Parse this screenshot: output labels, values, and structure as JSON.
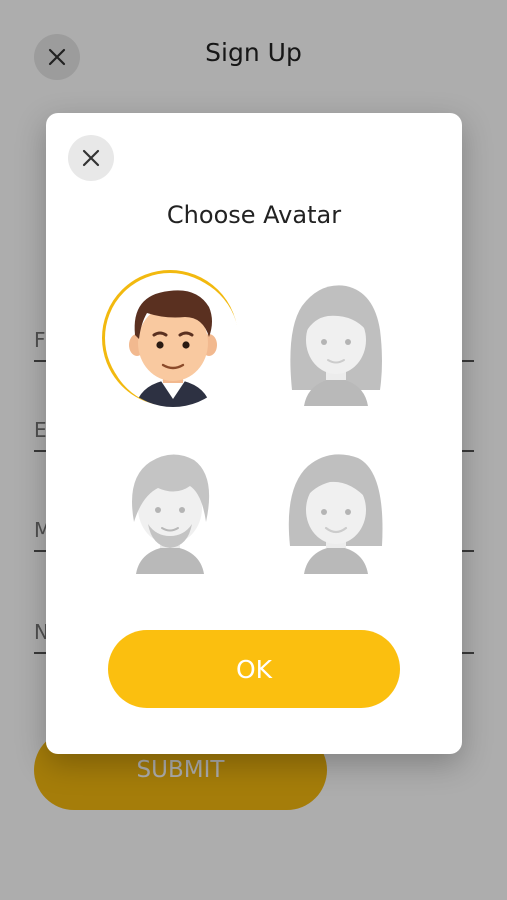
{
  "header": {
    "title": "Sign Up"
  },
  "form": {
    "fields": [
      {
        "label": "F"
      },
      {
        "label": "E"
      },
      {
        "label": "M"
      },
      {
        "label": "N"
      }
    ],
    "submit_label": "SUBMIT"
  },
  "modal": {
    "title": "Choose Avatar",
    "ok_label": "OK",
    "avatars": [
      {
        "name": "man-short-hair",
        "selected": true
      },
      {
        "name": "woman-long-hair",
        "selected": false
      },
      {
        "name": "man-bearded",
        "selected": false
      },
      {
        "name": "woman-bob-hair",
        "selected": false
      }
    ]
  },
  "colors": {
    "accent": "#fbbf0f",
    "selected_ring": "#f2b90f",
    "overlay": "#000000"
  },
  "icons": {
    "close": "close-icon"
  }
}
